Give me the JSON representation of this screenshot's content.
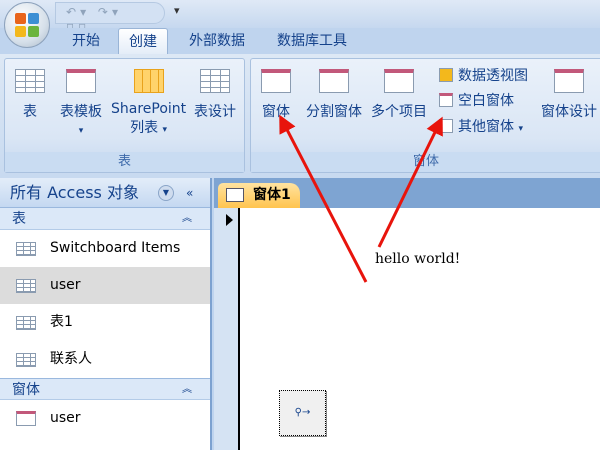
{
  "quick_access": {
    "undo": "↶",
    "redo": "↷",
    "more": "▾"
  },
  "tabs": [
    "开始",
    "创建",
    "外部数据",
    "数据库工具"
  ],
  "active_tab": "创建",
  "ribbon": {
    "groups": [
      {
        "label": "表",
        "buttons": [
          "表",
          "表模板",
          "SharePoint",
          "列表",
          "表设计"
        ]
      },
      {
        "label": "窗体",
        "buttons": [
          "窗体",
          "分割窗体",
          "多个项目",
          "数据透视图",
          "空白窗体",
          "其他窗体",
          "窗体设计"
        ]
      }
    ]
  },
  "nav": {
    "title": "所有 Access 对象",
    "sections": [
      {
        "label": "表",
        "items": [
          "Switchboard Items",
          "user",
          "表1",
          "联系人"
        ]
      },
      {
        "label": "窗体",
        "items": [
          "user"
        ]
      }
    ],
    "selected": "user"
  },
  "document": {
    "tab": "窗体1",
    "label_text": "hello world!"
  },
  "colors": {
    "arrow": "#e8140c",
    "tab_active": "#ffc44f"
  }
}
